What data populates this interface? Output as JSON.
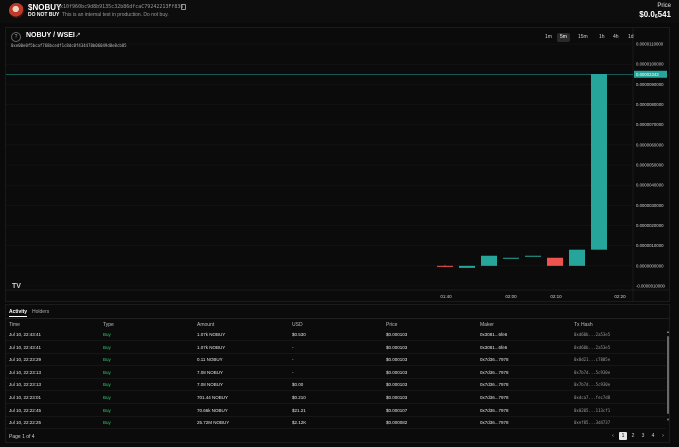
{
  "header": {
    "symbol": "$NOBUY",
    "address": "0x10f960bc9d8b9135c32b86dfcaC79242213Ff836",
    "warning": "DO NOT BUY",
    "warning_sub": "This is an internal test in production. Do not buy.",
    "price_label": "Price",
    "price_main": "$0.0",
    "price_sub": "6",
    "price_tail": "541"
  },
  "chart": {
    "pair": "NOBUY / WSEI",
    "pair_address": "0xe00e0f5bcaf768bcedf1c8dc0f434478b06049d8e8cb85",
    "timeframes": [
      "1m",
      "5m",
      "15m",
      "1h",
      "4h",
      "1d"
    ],
    "active_timeframe": "5m",
    "logo_text": "TV",
    "current_price_label": "0.00002343",
    "colors": {
      "up": "#26a69a",
      "down": "#ef5350",
      "grid": "#1a1a1a"
    }
  },
  "chart_data": {
    "type": "candlestick",
    "y_ticks": [
      "0.0000110000",
      "0.0000100000",
      "0.0000090000",
      "0.0000080000",
      "0.0000070000",
      "0.0000060000",
      "0.0000050000",
      "0.0000040000",
      "0.0000030000",
      "0.0000020000",
      "0.0000010000",
      "0.0000000000",
      "-0.0000010000"
    ],
    "x_ticks": [
      "01:40",
      "02:00",
      "02:10",
      "02:20"
    ],
    "ylim": [
      -1e-06,
      1.11e-05
    ],
    "candles": [
      {
        "open": 0.0,
        "close": -5e-08,
        "high": 5e-08,
        "low": -5e-08,
        "dir": "down"
      },
      {
        "open": -1e-07,
        "close": 0.0,
        "high": 0.0,
        "low": -1e-07,
        "dir": "up"
      },
      {
        "open": 0.0,
        "close": 5e-07,
        "high": 5e-07,
        "low": 0.0,
        "dir": "up"
      },
      {
        "open": 4e-07,
        "close": 4e-07,
        "high": 4e-07,
        "low": 4e-07,
        "dir": "up"
      },
      {
        "open": 5e-07,
        "close": 5e-07,
        "high": 5e-07,
        "low": 5e-07,
        "dir": "up"
      },
      {
        "open": 4e-07,
        "close": 0.0,
        "high": 4e-07,
        "low": 0.0,
        "dir": "down"
      },
      {
        "open": 0.0,
        "close": 8e-07,
        "high": 8e-07,
        "low": 0.0,
        "dir": "up"
      },
      {
        "open": 8e-07,
        "close": 9.5e-06,
        "high": 9.5e-06,
        "low": 8e-07,
        "dir": "up"
      }
    ]
  },
  "activity": {
    "tabs": [
      "Activity",
      "Holders"
    ],
    "columns": [
      "Time",
      "Type",
      "Amount",
      "USD",
      "Price",
      "Maker",
      "Tx Hash"
    ],
    "rows": [
      [
        "Jul 10, 22:43:41",
        "Buy",
        "1.07k NOBUY",
        "$0.530",
        "$0.000103",
        "0x3081...6fe6",
        "0xd60b...2a53e5"
      ],
      [
        "Jul 10, 22:43:41",
        "Buy",
        "1.07k NOBUY",
        "-",
        "$0.000103",
        "0x3081...6fe6",
        "0xd60b...2a53e5"
      ],
      [
        "Jul 10, 22:23:29",
        "Buy",
        "0.11 NOBUY",
        "-",
        "$0.000103",
        "0x7d36...7978",
        "0x0d21...c7805e"
      ],
      [
        "Jul 10, 22:23:13",
        "Buy",
        "7.08 NOBUY",
        "-",
        "$0.000103",
        "0x7d36...7978",
        "0x7b7d...5c930e"
      ],
      [
        "Jul 10, 22:23:13",
        "Buy",
        "7.08 NOBUY",
        "$0.00",
        "$0.000103",
        "0x7d36...7978",
        "0x7b7d...5c930e"
      ],
      [
        "Jul 10, 22:23:01",
        "Buy",
        "701.44 NOBUY",
        "$0.210",
        "$0.000103",
        "0x7d36...7978",
        "0xdca7...fec7d8"
      ],
      [
        "Jul 10, 22:22:45",
        "Buy",
        "70.66k NOBUY",
        "$21.21",
        "$0.000107",
        "0x7d36...7978",
        "0x0205...113cf1"
      ],
      [
        "Jul 10, 22:22:25",
        "Buy",
        "25.72M NOBUY",
        "$2.12K",
        "$0.000082",
        "0x7d36...7978",
        "0xef85...3d4737"
      ]
    ],
    "page_info": "Page 1 of 4",
    "pages": [
      "1",
      "2",
      "3",
      "4"
    ],
    "prev": "‹",
    "next": "›"
  }
}
